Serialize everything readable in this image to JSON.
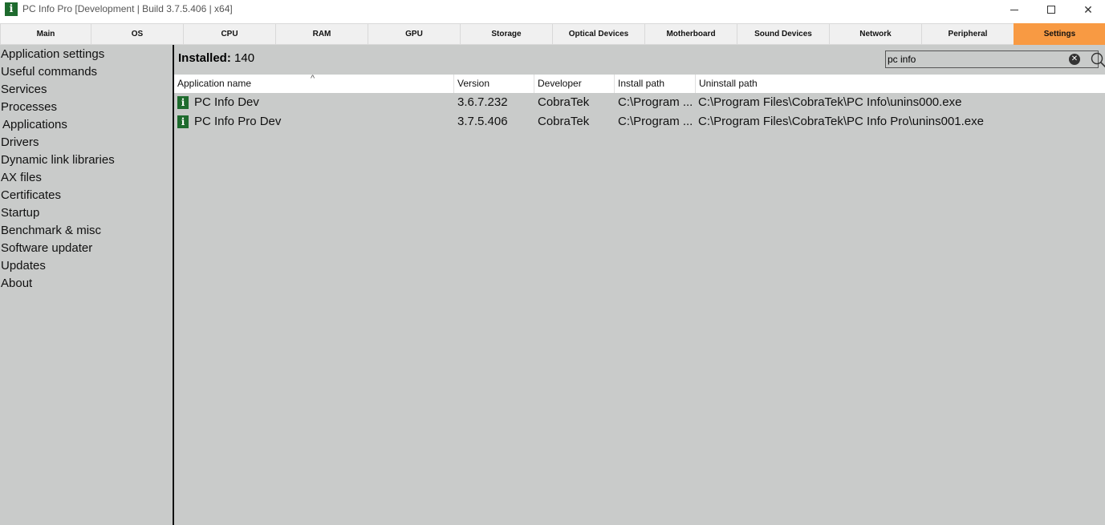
{
  "window": {
    "title": "PC Info Pro [Development | Build 3.7.5.406 | x64]",
    "app_icon_glyph": "i",
    "close_glyph": "✕"
  },
  "tabs": [
    {
      "label": "Main"
    },
    {
      "label": "OS"
    },
    {
      "label": "CPU"
    },
    {
      "label": "RAM"
    },
    {
      "label": "GPU"
    },
    {
      "label": "Storage"
    },
    {
      "label": "Optical Devices"
    },
    {
      "label": "Motherboard"
    },
    {
      "label": "Sound Devices"
    },
    {
      "label": "Network"
    },
    {
      "label": "Peripheral"
    },
    {
      "label": "Settings",
      "active": true
    }
  ],
  "sidebar": {
    "items": [
      {
        "label": "Application settings"
      },
      {
        "label": "Useful commands"
      },
      {
        "label": "Services"
      },
      {
        "label": "Processes"
      },
      {
        "label": "Applications"
      },
      {
        "label": "Drivers"
      },
      {
        "label": "Dynamic link libraries"
      },
      {
        "label": "AX files"
      },
      {
        "label": "Certificates"
      },
      {
        "label": "Startup"
      },
      {
        "label": "Benchmark & misc"
      },
      {
        "label": "Software updater"
      },
      {
        "label": "Updates"
      },
      {
        "label": "About"
      }
    ]
  },
  "main": {
    "installed_label": "Installed:",
    "installed_count": "140",
    "search": {
      "value": "pc info",
      "placeholder": ""
    },
    "columns": [
      {
        "label": "Application name"
      },
      {
        "label": "Version"
      },
      {
        "label": "Developer"
      },
      {
        "label": "Install path"
      },
      {
        "label": "Uninstall path"
      }
    ],
    "rows": [
      {
        "name": "PC Info Dev",
        "version": "3.6.7.232",
        "developer": "CobraTek",
        "install_path": "C:\\Program ...",
        "uninstall_path": "C:\\Program Files\\CobraTek\\PC Info\\unins000.exe"
      },
      {
        "name": "PC Info Pro Dev",
        "version": "3.7.5.406",
        "developer": "CobraTek",
        "install_path": "C:\\Program ...",
        "uninstall_path": "C:\\Program Files\\CobraTek\\PC Info Pro\\unins001.exe"
      }
    ]
  },
  "colors": {
    "accent": "#f89a43",
    "panel_bg": "#c9cbca",
    "icon_green": "#1e6b2e"
  }
}
